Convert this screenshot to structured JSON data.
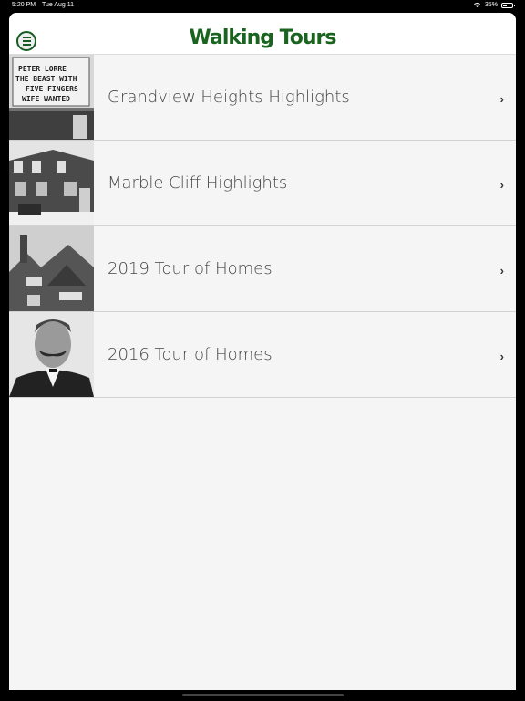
{
  "status_bar": {
    "time": "5:20 PM",
    "date": "Tue Aug 11",
    "battery": "35%",
    "battery_level": 0.35
  },
  "header": {
    "title": "Walking Tours",
    "menu_icon": "hamburger-menu-icon",
    "accent_color": "#1a641f"
  },
  "tours": [
    {
      "label": "Grandview Heights Highlights",
      "thumbnail": "theater-marquee-photo"
    },
    {
      "label": "Marble Cliff Highlights",
      "thumbnail": "historic-house-photo"
    },
    {
      "label": "2019 Tour of Homes",
      "thumbnail": "stone-house-photo"
    },
    {
      "label": "2016 Tour of Homes",
      "thumbnail": "portrait-photo"
    }
  ]
}
